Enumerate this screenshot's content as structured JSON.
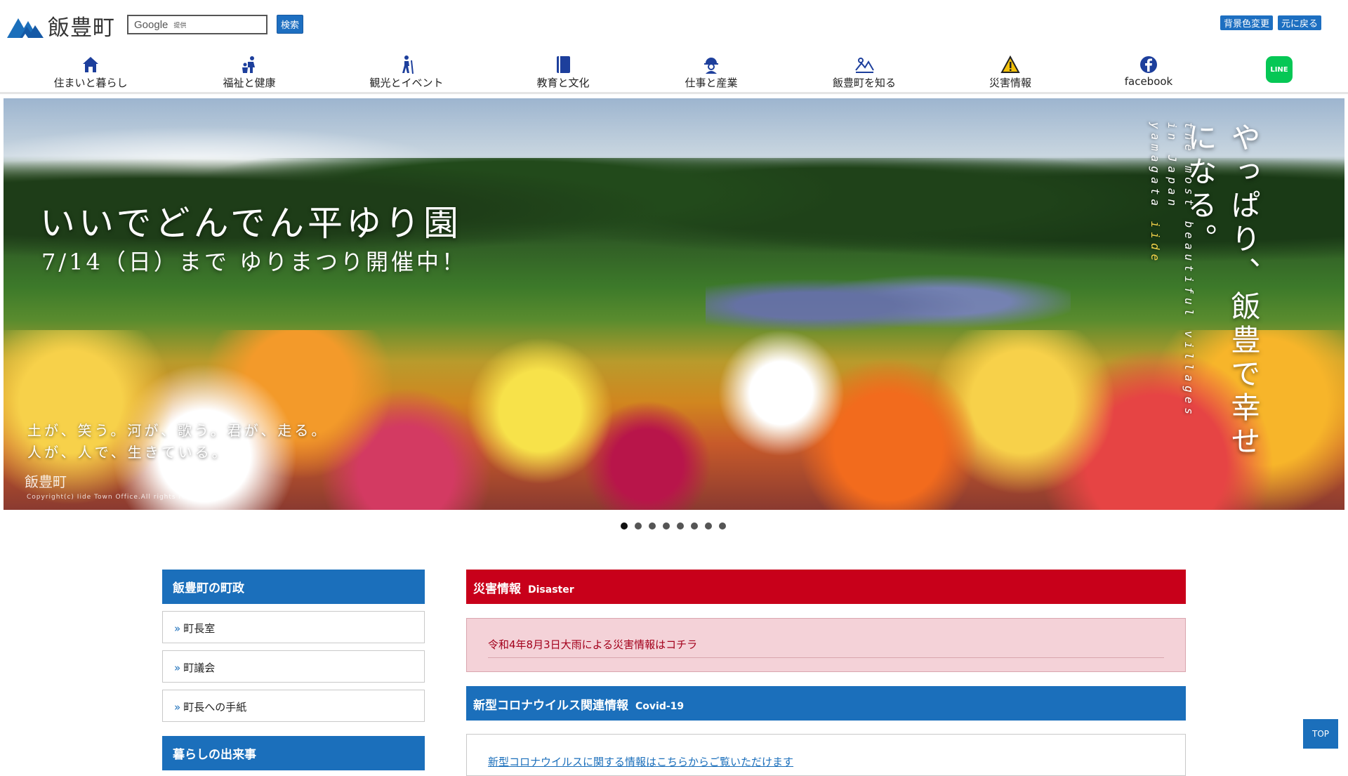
{
  "header": {
    "site_name": "飯豊町",
    "search": {
      "brand": "Google",
      "sub": "提供",
      "button": "検索"
    },
    "tools": {
      "bg_change": "背景色変更",
      "reset": "元に戻る"
    }
  },
  "nav": {
    "items": [
      {
        "label": "住まいと暮らし",
        "icon": "house-icon"
      },
      {
        "label": "福祉と健康",
        "icon": "family-icon"
      },
      {
        "label": "観光とイベント",
        "icon": "hiker-icon"
      },
      {
        "label": "教育と文化",
        "icon": "book-icon"
      },
      {
        "label": "仕事と産業",
        "icon": "worker-icon"
      },
      {
        "label": "飯豊町を知る",
        "icon": "landscape-icon"
      },
      {
        "label": "災害情報",
        "icon": "warning-icon"
      },
      {
        "label": "facebook",
        "icon": "facebook-icon"
      },
      {
        "label": "LINE",
        "icon": "line-icon"
      }
    ]
  },
  "hero": {
    "title": "いいでどんでん平ゆり園",
    "subtitle": "7/14（日）まで ゆりまつり開催中！",
    "poem_line1": "土が、笑う。河が、歌う。君が、走る。",
    "poem_line2": "人が、人で、生きている。",
    "mark": "飯豊町",
    "copyright": "Copyright(c) Iide Town Office.All rights reserved.",
    "vertical_main": "やっぱり、飯豊で幸せになる。",
    "vertical_en1": "the most beautiful villages in Japan",
    "vertical_en2_a": "yamagata ",
    "vertical_en2_b": "iide"
  },
  "slider": {
    "count": 8,
    "active": 1
  },
  "sidebar": {
    "heading": "飯豊町の町政",
    "links": [
      "町長室",
      "町議会",
      "町長への手紙"
    ],
    "heading2": "暮らしの出来事"
  },
  "main": {
    "disaster": {
      "jp": "災害情報",
      "en": "Disaster",
      "link": "令和4年8月3日大雨による災害情報はコチラ"
    },
    "covid": {
      "jp": "新型コロナウイルス関連情報",
      "en": "Covid-19",
      "link": "新型コロナウイルスに関する情報はこちらからご覧いただけます"
    }
  },
  "top_button": "TOP",
  "colors": {
    "brand_blue": "#1b6fbb",
    "disaster_red": "#c8001a",
    "line_green": "#06c755"
  }
}
